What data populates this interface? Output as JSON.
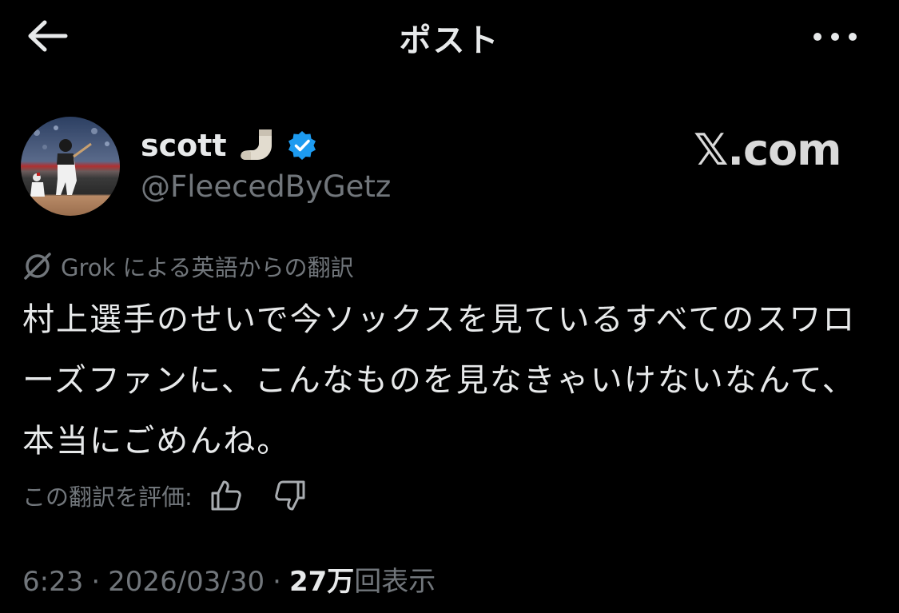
{
  "header": {
    "title": "ポスト",
    "back_icon": "arrow-left-icon",
    "more_icon": "more-horizontal-icon"
  },
  "author": {
    "display_name": "scott",
    "emoji_icon": "sock-emoji",
    "verified_icon": "verified-badge-icon",
    "verified_color": "#1d9bf0",
    "handle": "@FleecedByGetz"
  },
  "watermark": {
    "text": "𝕏.com"
  },
  "translation": {
    "label": "Grok による英語からの翻訳",
    "text": "村上選手のせいで今ソックスを見ているすべてのスワローズファンに、こんなものを見なきゃいけないなんて、本当にごめんね。",
    "rate_label": "この翻訳を評価:",
    "rate_up_icon": "thumbs-up-icon",
    "rate_down_icon": "thumbs-down-icon"
  },
  "meta": {
    "time": "6:23",
    "separator": "·",
    "date": "2026/03/30",
    "views_count": "27万",
    "views_label": "回表示"
  },
  "colors": {
    "background": "#000000",
    "text_primary": "#e7e9ea",
    "text_secondary": "#71767b",
    "accent": "#1d9bf0"
  }
}
